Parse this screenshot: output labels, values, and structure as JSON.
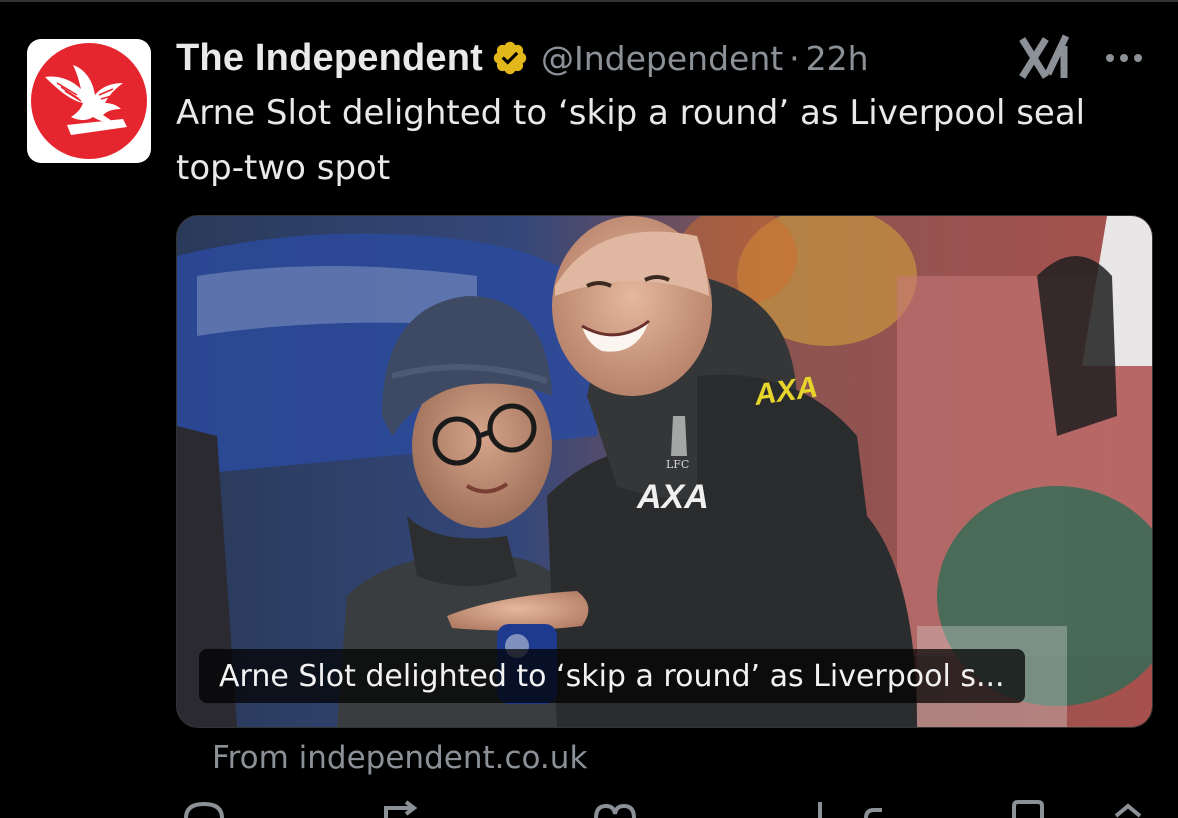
{
  "tweet": {
    "author_name": "The Independent",
    "handle": "@Independent",
    "separator": "·",
    "time": "22h",
    "text": "Arne Slot delighted to ‘skip a round’ as Liverpool seal top-two spot",
    "verified_icon": "verified-gold-badge-icon",
    "avatar_icon": "eagle-logo-icon"
  },
  "card": {
    "caption": "Arne Slot delighted to ‘skip a round’ as Liverpool s...",
    "source": "From independent.co.uk",
    "jacket_logo": "AXA",
    "shoulder_logo": "AXA",
    "crest_text": "LFC"
  },
  "colors": {
    "background": "#000000",
    "text": "#e7e9ea",
    "muted": "#8b9197",
    "brand_red": "#e5262e",
    "verified_gold": "#e2b719"
  },
  "actions": [
    "reply-icon",
    "repost-icon",
    "like-icon",
    "views-icon",
    "bookmark-icon",
    "share-icon"
  ]
}
